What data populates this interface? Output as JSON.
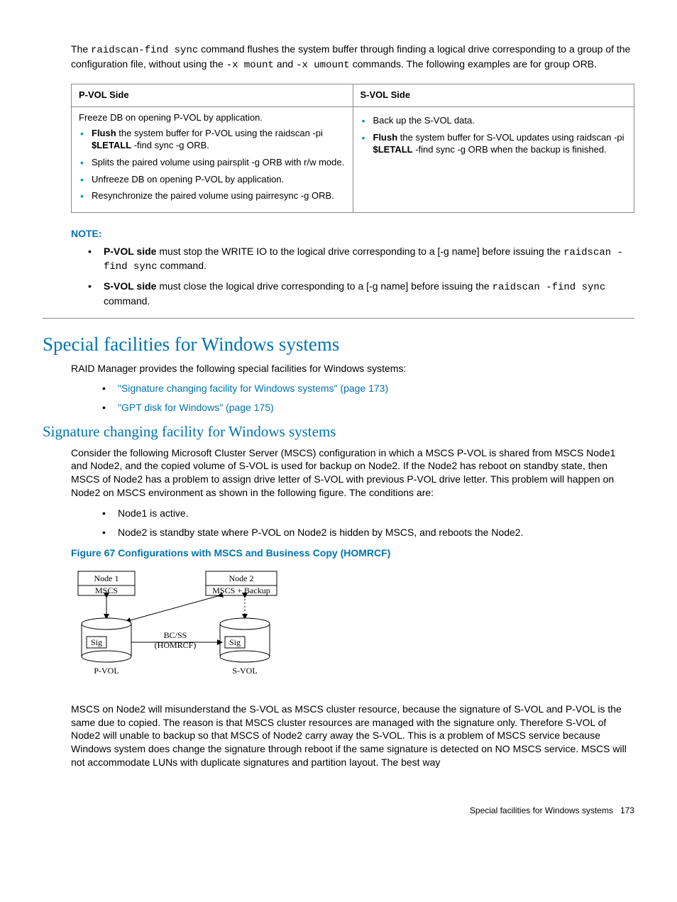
{
  "intro": {
    "p1_a": "The ",
    "p1_cmd": "raidscan-find sync",
    "p1_b": " command flushes the system buffer through finding a logical drive corresponding to a group of the configuration file, without using the ",
    "p1_opt1": "-x mount",
    "p1_c": " and ",
    "p1_opt2": "-x umount",
    "p1_d": " commands. The following examples are for group ORB."
  },
  "table": {
    "h1": "P-VOL Side",
    "h2": "S-VOL Side",
    "left": {
      "lead": "Freeze DB on opening P-VOL by application.",
      "items": [
        {
          "b": "Flush",
          "rest": " the system buffer for P-VOL using the raidscan -pi ",
          "b2": "$LETALL",
          "rest2": " -find sync -g ORB."
        },
        {
          "plain": "Splits the paired volume using pairsplit -g ORB with r/w mode."
        },
        {
          "plain": "Unfreeze DB on opening P-VOL by application."
        },
        {
          "plain": "Resynchronize the paired volume using pairresync -g ORB."
        }
      ]
    },
    "right": {
      "items": [
        {
          "plain": "Back up the S-VOL data."
        },
        {
          "b": "Flush",
          "rest": " the system buffer for S-VOL updates using raidscan -pi ",
          "b2": "$LETALL",
          "rest2": " -find sync -g ORB when the backup is finished."
        }
      ]
    }
  },
  "note": {
    "heading": "NOTE:",
    "items": [
      {
        "b": "P-VOL side",
        "rest_a": " must stop the WRITE IO to the logical drive corresponding to a [-g name] before issuing the ",
        "cmd": "raidscan -find sync",
        "rest_b": " command."
      },
      {
        "b": "S-VOL side",
        "rest_a": " must close the logical drive corresponding to a [-g name] before issuing the ",
        "cmd": "raidscan -find sync",
        "rest_b": " command."
      }
    ]
  },
  "sec1": {
    "title": "Special facilities for Windows systems",
    "lead": "RAID Manager provides the following special facilities for Windows systems:",
    "links": [
      "\"Signature changing facility for Windows systems\" (page 173)",
      "\"GPT disk for Windows\" (page 175)"
    ]
  },
  "sec2": {
    "title": "Signature changing facility for Windows systems",
    "para1": "Consider the following Microsoft Cluster Server (MSCS) configuration in which a MSCS P-VOL is shared from MSCS Node1 and Node2, and the copied volume of S-VOL is used for backup on Node2. If the Node2 has reboot on standby state, then MSCS of Node2 has a problem to assign drive letter of S-VOL with previous P-VOL drive letter. This problem will happen on Node2 on MSCS environment as shown in the following figure. The conditions are:",
    "conds": [
      "Node1 is active.",
      "Node2 is standby state where P-VOL on Node2 is hidden by MSCS, and reboots the Node2."
    ],
    "fig_title": "Figure 67 Configurations with MSCS and Business Copy (HOMRCF)",
    "fig": {
      "node1": "Node 1",
      "mscs": "MSCS",
      "sig1": "Sig",
      "pvol": "P-VOL",
      "bcss": "BC/SS",
      "homrcf": "(HOMRCF)",
      "node2": "Node 2",
      "mscsb": "MSCS + Backup",
      "sig2": "Sig",
      "svol": "S-VOL"
    },
    "para2": "MSCS on Node2 will misunderstand the S-VOL as MSCS cluster resource, because the signature of S-VOL and P-VOL is the same due to copied. The reason is that MSCS cluster resources are managed with the signature only. Therefore S-VOL of Node2 will unable to backup so that MSCS of Node2 carry away the S-VOL. This is a problem of MSCS service because Windows system does change the signature through reboot if the same signature is detected on NO MSCS service. MSCS will not accommodate LUNs with duplicate signatures and partition layout. The best way"
  },
  "footer": {
    "text": "Special facilities for Windows systems",
    "page": "173"
  }
}
